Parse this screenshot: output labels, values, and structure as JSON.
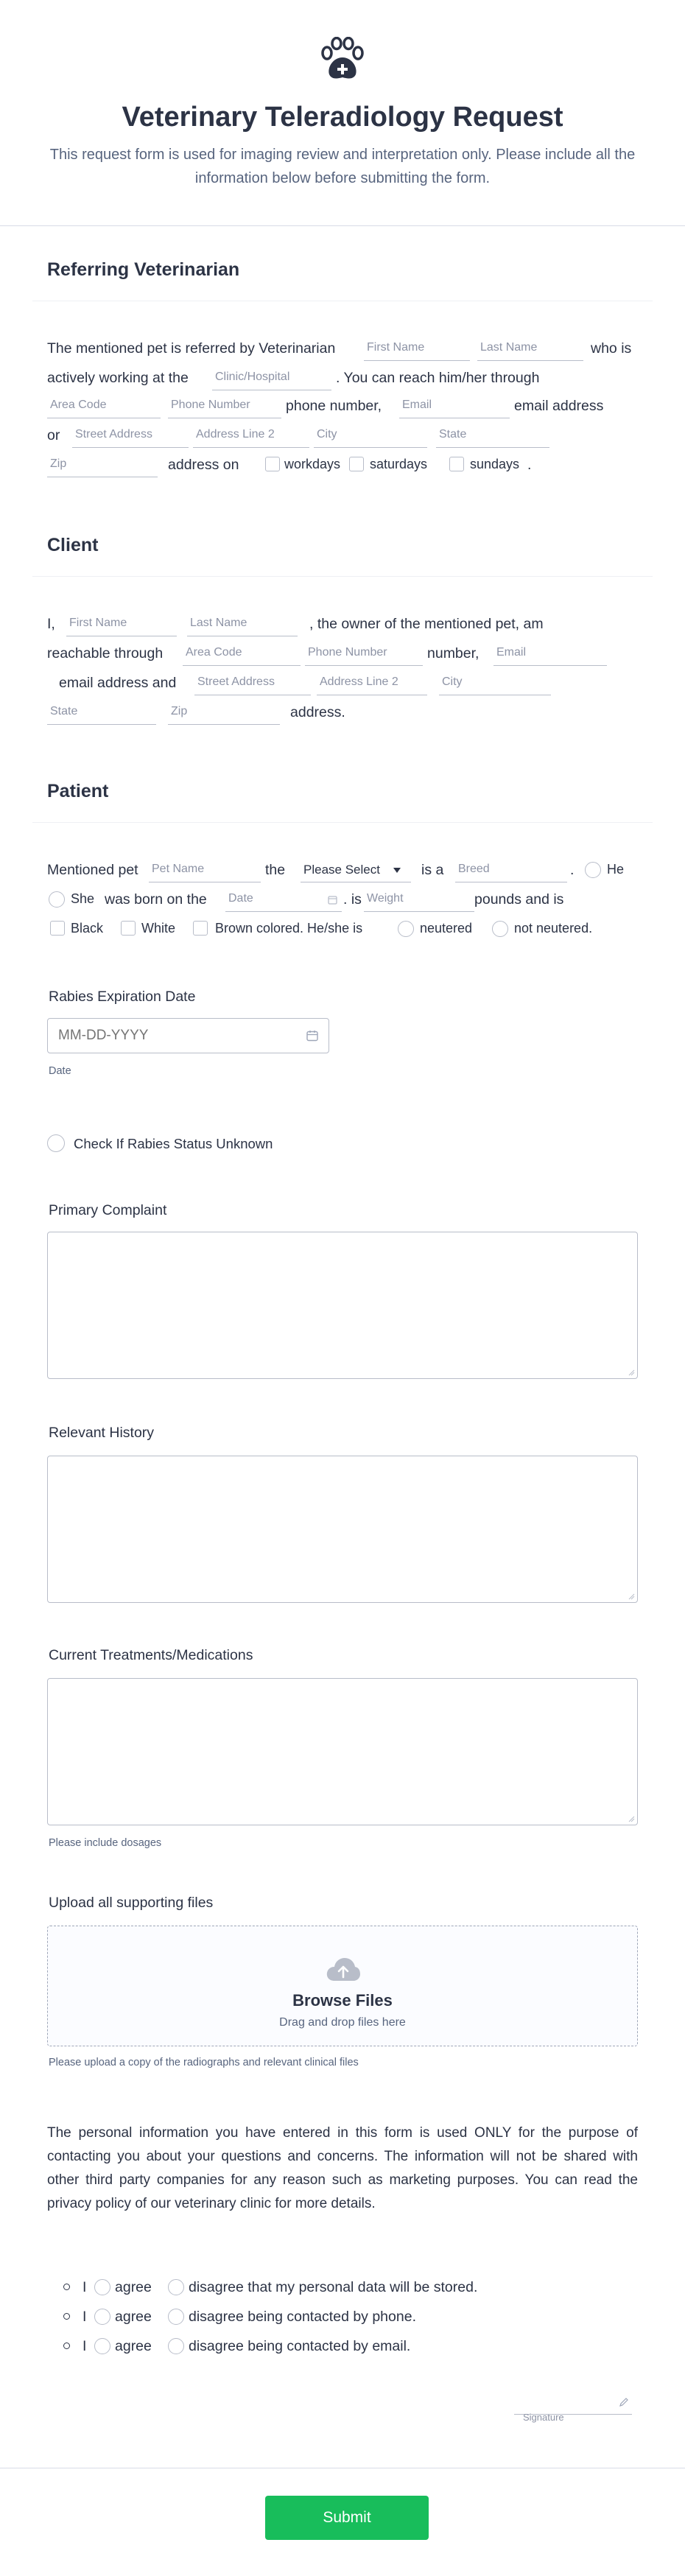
{
  "header": {
    "title": "Veterinary Teleradiology Request",
    "subtitle": "This request form is used for imaging review and interpretation only. Please include all the information below before submitting the form."
  },
  "referring": {
    "title": "Referring Veterinarian",
    "t1": "The mentioned pet is referred by Veterinarian",
    "first_name": "First Name",
    "last_name": "Last Name",
    "t2": "who is",
    "t3": "actively working at the",
    "clinic": "Clinic/Hospital",
    "t4": ". You can reach him/her through",
    "area_code": "Area Code",
    "phone": "Phone Number",
    "t5": "phone number,",
    "email": "Email",
    "t6": "email address",
    "t7": "or",
    "street": "Street Address",
    "address2": "Address Line 2",
    "city": "City",
    "state": "State",
    "zip": "Zip",
    "t8": "address on",
    "workdays": "workdays",
    "saturdays": "saturdays",
    "sundays": "sundays",
    "t9": "."
  },
  "client": {
    "title": "Client",
    "t1": "I,",
    "first_name": "First Name",
    "last_name": "Last Name",
    "t2": ", the owner of the mentioned pet, am",
    "t3": "reachable through",
    "area_code": "Area Code",
    "phone": "Phone Number",
    "t4": "number,",
    "email": "Email",
    "t5": "email address and",
    "street": "Street Address",
    "address2": "Address Line 2",
    "city": "City",
    "state": "State",
    "zip": "Zip",
    "t6": "address."
  },
  "patient": {
    "title": "Patient",
    "t1": "Mentioned pet",
    "pet_name": "Pet Name",
    "t2": "the",
    "species_selected": "Please Select",
    "t3": "is a",
    "breed": "Breed",
    "t4": ".",
    "he": "He",
    "she": "She",
    "t5": "was born on the",
    "date": "Date",
    "t6": ". is",
    "weight": "Weight",
    "t7": "pounds and is",
    "black": "Black",
    "white": "White",
    "brown": "Brown colored. He/she is",
    "neutered": "neutered",
    "not_neutered": "not neutered."
  },
  "rabies": {
    "label": "Rabies Expiration Date",
    "placeholder": "MM-DD-YYYY",
    "sublabel": "Date",
    "unknown": "Check If Rabies Status Unknown"
  },
  "complaint": {
    "label": "Primary Complaint"
  },
  "history": {
    "label": "Relevant History"
  },
  "treatments": {
    "label": "Current Treatments/Medications",
    "sublabel": "Please include dosages"
  },
  "upload": {
    "label": "Upload all supporting files",
    "browse": "Browse Files",
    "drag": "Drag and drop files here",
    "sublabel": "Please upload a copy of the radiographs and relevant clinical files"
  },
  "privacy": "The personal information you have entered in this form is used ONLY for the purpose of contacting you about your questions and concerns. The information will not be shared with other third party companies for any reason such as marketing purposes. You can read the privacy policy of our veterinary clinic for more details.",
  "consents": [
    {
      "i": "I",
      "agree": "agree",
      "disagree": "disagree that my personal data will be stored."
    },
    {
      "i": "I",
      "agree": "agree",
      "disagree": "disagree being contacted by phone."
    },
    {
      "i": "I",
      "agree": "agree",
      "disagree": "disagree being contacted by email."
    }
  ],
  "signature": {
    "label": "Signature"
  },
  "submit": "Submit",
  "colors": {
    "accent": "#18bd5b",
    "text": "#2c3345",
    "muted": "#57647e",
    "border": "#b8bdc9"
  },
  "icons": [
    "paw-medical-icon",
    "calendar-icon",
    "cloud-upload-icon",
    "pen-icon",
    "chevron-down-icon"
  ]
}
